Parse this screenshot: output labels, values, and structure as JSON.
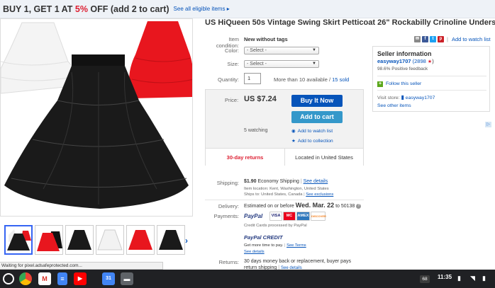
{
  "promo": {
    "text_before": "BUY 1, GET 1 AT ",
    "percent": "5%",
    "text_after": " OFF (add 2 to cart)",
    "link": "See all eligible items ▸"
  },
  "product": {
    "title": "US HiQueen 50s Vintage Swing Skirt Petticoat 26\" Rockabilly Crinoline Underskirt",
    "condition_label": "Item condition:",
    "condition_value": "New without tags",
    "color_label": "Color:",
    "color_value": "- Select -",
    "size_label": "Size:",
    "size_value": "- Select -",
    "quantity_label": "Quantity:",
    "quantity_value": "1",
    "available_text": "More than 10 available / ",
    "sold_text": "15 sold"
  },
  "share": {
    "watch_link": "Add to watch list",
    "separator": "|"
  },
  "purchase": {
    "price_label": "Price:",
    "price": "US $7.24",
    "buy_now": "Buy It Now",
    "add_to_cart": "Add to cart",
    "watching": "5 watching",
    "add_watch": "Add to watch list",
    "add_collection": "Add to collection",
    "returns": "30-day returns",
    "location": "Located in United States"
  },
  "shipping": {
    "label": "Shipping:",
    "cost": "$1.90",
    "method": "Economy Shipping",
    "see_details": "See details",
    "item_location": "Item location:  Kent, Washington, United States",
    "ships_to": "Ships to:  United States, Canada",
    "see_exclusions": "See exclusions"
  },
  "delivery": {
    "label": "Delivery:",
    "prefix": "Estimated on or before ",
    "date": "Wed. Mar. 22",
    "suffix": " to 50138"
  },
  "payments": {
    "label": "Payments:",
    "paypal": "PayPal",
    "cards": [
      "VISA",
      "MC",
      "AMEX",
      "DISCOVER"
    ],
    "processed": "Credit Cards processed by PayPal",
    "credit_logo": "PayPal CREDIT",
    "credit_text": "Get more time to pay.",
    "see_terms": "See Terms",
    "see_details": "See details"
  },
  "returns_row": {
    "label": "Returns:",
    "text": "30 days money back or replacement, buyer pays",
    "text2": "return shipping",
    "see_details": "See details"
  },
  "seller": {
    "heading": "Seller information",
    "username": "easyway1707",
    "score": "(2898",
    "star": "★",
    "score_close": ")",
    "feedback": "98.6% Positive feedback",
    "follow": "Follow this seller",
    "visit_label": "Visit store:",
    "store_name": "easyway1707",
    "see_other": "See other items"
  },
  "status_bar": "Waiting for pixel.adsafeprotected.com...",
  "taskbar": {
    "badge": "68",
    "time": "11:35"
  },
  "colors": {
    "accent": "#0654ba",
    "promo_red": "#dd1e31",
    "cart_blue": "#3498ca"
  }
}
